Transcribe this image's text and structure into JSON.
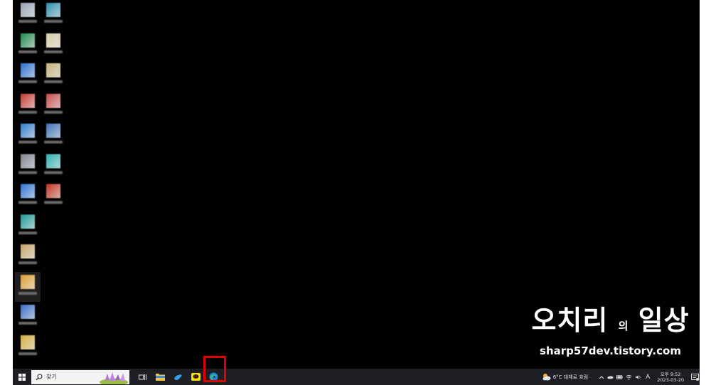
{
  "watermark": {
    "title_part1": "오치리",
    "title_small": "의",
    "title_part2": "일상",
    "subtitle": "sharp57dev.tistory.com"
  },
  "desktop_icons": [
    {
      "col": 0,
      "row": 0,
      "color": "#9aa6b8",
      "icon": "app-icon"
    },
    {
      "col": 1,
      "row": 0,
      "color": "#2d8fb0",
      "icon": "app-icon"
    },
    {
      "col": 0,
      "row": 1,
      "color": "#1f8a4c",
      "icon": "excel-icon"
    },
    {
      "col": 1,
      "row": 1,
      "color": "#d8cfa8",
      "icon": "file-icon"
    },
    {
      "col": 0,
      "row": 2,
      "color": "#2a6fd6",
      "icon": "app-icon"
    },
    {
      "col": 1,
      "row": 2,
      "color": "#c9b37a",
      "icon": "file-icon"
    },
    {
      "col": 0,
      "row": 3,
      "color": "#c93a2f",
      "icon": "app-icon"
    },
    {
      "col": 1,
      "row": 3,
      "color": "#c84a4a",
      "icon": "app-icon"
    },
    {
      "col": 0,
      "row": 4,
      "color": "#2f7fd0",
      "icon": "app-icon"
    },
    {
      "col": 1,
      "row": 4,
      "color": "#3d73b8",
      "icon": "app-icon"
    },
    {
      "col": 0,
      "row": 5,
      "color": "#7d8590",
      "icon": "app-icon"
    },
    {
      "col": 1,
      "row": 5,
      "color": "#2cb3b3",
      "icon": "app-icon"
    },
    {
      "col": 0,
      "row": 6,
      "color": "#2c76d8",
      "icon": "app-icon"
    },
    {
      "col": 1,
      "row": 6,
      "color": "#c5321e",
      "icon": "app-icon"
    },
    {
      "col": 0,
      "row": 7,
      "color": "#1e9a9a",
      "icon": "edge-icon"
    },
    {
      "col": 0,
      "row": 8,
      "color": "#c9a86a",
      "icon": "app-icon"
    },
    {
      "col": 0,
      "row": 9,
      "color": "#e0a030",
      "icon": "chrome-icon",
      "selected": true
    },
    {
      "col": 0,
      "row": 10,
      "color": "#3a6ec8",
      "icon": "app-icon"
    },
    {
      "col": 0,
      "row": 11,
      "color": "#d8b040",
      "icon": "folder-icon"
    }
  ],
  "taskbar": {
    "search_placeholder": "찾기",
    "apps": [
      {
        "name": "task-view-icon"
      },
      {
        "name": "file-explorer-icon"
      },
      {
        "name": "bird-app-icon"
      },
      {
        "name": "kakaotalk-icon"
      },
      {
        "name": "edge-icon"
      }
    ],
    "weather": "6°C  대체로 흐림",
    "input_indicator": "A",
    "clock_time": "오후 9:52",
    "clock_date": "2023-03-20"
  },
  "colors": {
    "desktop_bg": "#010101",
    "taskbar_bg": "#1e1f24",
    "highlight": "#e00000"
  }
}
